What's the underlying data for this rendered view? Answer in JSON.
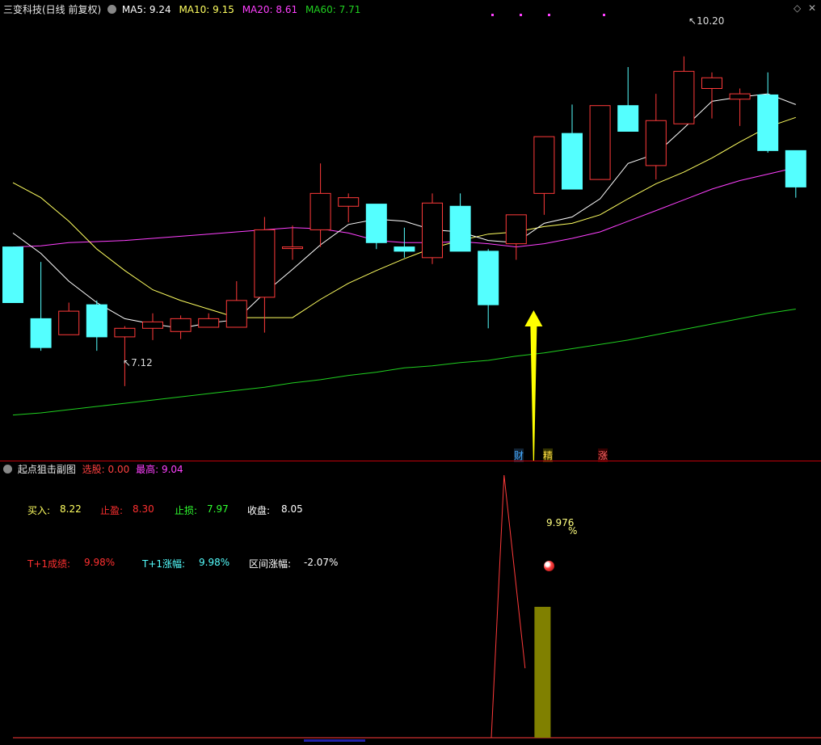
{
  "main": {
    "title": "三变科技(日线 前复权)",
    "ma5_label": "MA5: 9.24",
    "ma10_label": "MA10: 9.15",
    "ma20_label": "MA20: 8.61",
    "ma60_label": "MA60: 7.71",
    "high_marker": "10.20",
    "low_marker": "7.12",
    "event_tags": [
      "财",
      "精",
      "涨"
    ]
  },
  "sub": {
    "title": "起点狙击副图",
    "select_label": "选股:",
    "select_value": "0.00",
    "max_label": "最高:",
    "max_value": "9.04",
    "buy_label": "买入:",
    "buy_value": "8.22",
    "take_profit_label": "止盈:",
    "take_profit_value": "8.30",
    "stop_loss_label": "止损:",
    "stop_loss_value": "7.97",
    "close_label": "收盘:",
    "close_value": "8.05",
    "t1_result_label": "T+1成绩:",
    "t1_result_value": "9.98%",
    "t1_rise_label": "T+1涨幅:",
    "t1_rise_value": "9.98%",
    "range_rise_label": "区间涨幅:",
    "range_rise_value": "-2.07%",
    "peak_value": "9.976",
    "peak_unit": "%"
  },
  "colors": {
    "up": "#ff3a3a",
    "down": "#54ffff",
    "ma5": "#ffffff",
    "ma10": "#ffff60",
    "ma20": "#ff40ff",
    "ma60": "#20d020",
    "arrow": "#ffff00",
    "bar": "#808000"
  },
  "chart_data": {
    "type": "candlestick",
    "price_range": [
      6.5,
      10.5
    ],
    "candles": [
      {
        "open": 8.42,
        "high": 8.42,
        "low": 7.9,
        "close": 7.9
      },
      {
        "open": 7.75,
        "high": 8.28,
        "low": 7.45,
        "close": 7.48
      },
      {
        "open": 7.6,
        "high": 7.9,
        "low": 7.6,
        "close": 7.82
      },
      {
        "open": 7.88,
        "high": 7.92,
        "low": 7.45,
        "close": 7.58
      },
      {
        "open": 7.58,
        "high": 7.68,
        "low": 7.12,
        "close": 7.66
      },
      {
        "open": 7.66,
        "high": 7.8,
        "low": 7.55,
        "close": 7.72
      },
      {
        "open": 7.63,
        "high": 7.78,
        "low": 7.56,
        "close": 7.75
      },
      {
        "open": 7.67,
        "high": 7.8,
        "low": 7.67,
        "close": 7.75
      },
      {
        "open": 7.67,
        "high": 8.1,
        "low": 7.67,
        "close": 7.92
      },
      {
        "open": 7.95,
        "high": 8.7,
        "low": 7.62,
        "close": 8.58
      },
      {
        "open": 8.42,
        "high": 8.62,
        "low": 8.3,
        "close": 8.42
      },
      {
        "open": 8.58,
        "high": 9.2,
        "low": 8.42,
        "close": 8.92
      },
      {
        "open": 8.8,
        "high": 8.92,
        "low": 8.65,
        "close": 8.88
      },
      {
        "open": 8.82,
        "high": 8.82,
        "low": 8.4,
        "close": 8.46
      },
      {
        "open": 8.42,
        "high": 8.6,
        "low": 8.32,
        "close": 8.38
      },
      {
        "open": 8.32,
        "high": 8.92,
        "low": 8.26,
        "close": 8.83
      },
      {
        "open": 8.8,
        "high": 8.92,
        "low": 8.38,
        "close": 8.38
      },
      {
        "open": 8.38,
        "high": 8.4,
        "low": 7.66,
        "close": 7.88
      },
      {
        "open": 8.45,
        "high": 8.7,
        "low": 8.3,
        "close": 8.72
      },
      {
        "open": 8.92,
        "high": 9.45,
        "low": 8.72,
        "close": 9.45
      },
      {
        "open": 9.48,
        "high": 9.75,
        "low": 8.96,
        "close": 8.96
      },
      {
        "open": 9.05,
        "high": 9.74,
        "low": 9.05,
        "close": 9.74
      },
      {
        "open": 9.74,
        "high": 10.1,
        "low": 9.5,
        "close": 9.5
      },
      {
        "open": 9.18,
        "high": 9.85,
        "low": 9.05,
        "close": 9.6
      },
      {
        "open": 9.57,
        "high": 10.2,
        "low": 9.57,
        "close": 10.06
      },
      {
        "open": 9.9,
        "high": 10.05,
        "low": 9.62,
        "close": 10.0
      },
      {
        "open": 9.8,
        "high": 9.9,
        "low": 9.55,
        "close": 9.85
      },
      {
        "open": 9.84,
        "high": 10.05,
        "low": 9.3,
        "close": 9.32
      },
      {
        "open": 9.32,
        "high": 9.32,
        "low": 8.88,
        "close": 8.98
      }
    ],
    "ma5": [
      8.55,
      8.36,
      8.1,
      7.9,
      7.75,
      7.7,
      7.66,
      7.71,
      7.74,
      7.99,
      8.21,
      8.44,
      8.63,
      8.68,
      8.66,
      8.58,
      8.56,
      8.48,
      8.46,
      8.64,
      8.7,
      8.87,
      9.2,
      9.29,
      9.53,
      9.78,
      9.82,
      9.85,
      9.75
    ],
    "ma10": [
      9.02,
      8.88,
      8.66,
      8.4,
      8.2,
      8.02,
      7.92,
      7.84,
      7.76,
      7.76,
      7.76,
      7.93,
      8.08,
      8.2,
      8.31,
      8.41,
      8.48,
      8.54,
      8.56,
      8.61,
      8.64,
      8.72,
      8.87,
      9.01,
      9.12,
      9.25,
      9.4,
      9.54,
      9.63
    ],
    "ma20": [
      8.42,
      8.43,
      8.46,
      8.47,
      8.48,
      8.5,
      8.52,
      8.54,
      8.56,
      8.58,
      8.6,
      8.59,
      8.55,
      8.48,
      8.46,
      8.46,
      8.47,
      8.45,
      8.42,
      8.45,
      8.5,
      8.56,
      8.66,
      8.76,
      8.86,
      8.96,
      9.04,
      9.1,
      9.16
    ],
    "ma60": [
      6.85,
      6.87,
      6.9,
      6.93,
      6.96,
      6.99,
      7.02,
      7.05,
      7.08,
      7.11,
      7.15,
      7.18,
      7.22,
      7.25,
      7.29,
      7.31,
      7.34,
      7.36,
      7.4,
      7.43,
      7.47,
      7.51,
      7.55,
      7.6,
      7.65,
      7.7,
      7.75,
      7.8,
      7.84
    ],
    "signal_index": 19,
    "sub_peak_index": 18,
    "sub_peak_value": 9.976,
    "sub_bar_index": 19
  }
}
